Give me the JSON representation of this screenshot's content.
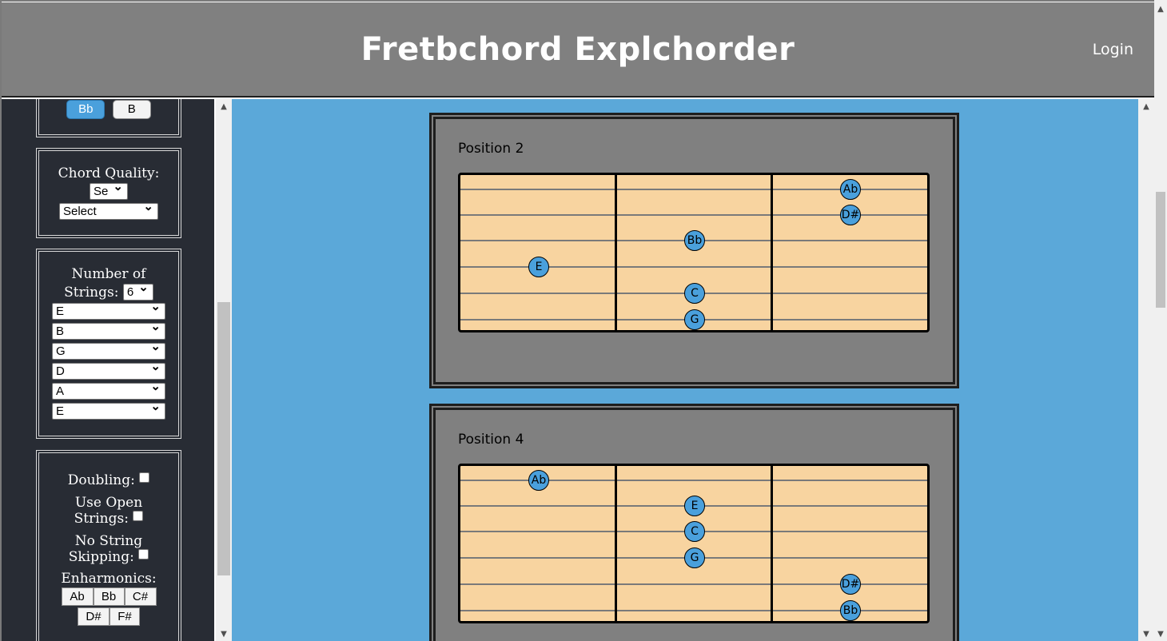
{
  "header": {
    "title": "Fretbchord Explchorder",
    "login": "Login"
  },
  "root_notes": {
    "buttons": [
      "Bb",
      "B"
    ],
    "active": "Bb"
  },
  "chord_quality": {
    "label": "Chord Quality:",
    "short_select": "Se",
    "select": "Select"
  },
  "strings": {
    "label_line1": "Number of",
    "label_line2": "Strings:",
    "count": "6",
    "tunings": [
      "E",
      "B",
      "G",
      "D",
      "A",
      "E"
    ]
  },
  "options": {
    "doubling": "Doubling:",
    "open_line1": "Use Open",
    "open_line2": "Strings:",
    "skip_line1": "No String",
    "skip_line2": "Skipping:",
    "enharmonics": "Enharmonics:",
    "enh_row1": [
      "Ab",
      "Bb",
      "C#"
    ],
    "enh_row2": [
      "D#",
      "F#"
    ]
  },
  "positions": [
    {
      "title": "Position 2",
      "notes": [
        {
          "label": "Ab",
          "string": 1,
          "fret": 3
        },
        {
          "label": "D#",
          "string": 2,
          "fret": 3
        },
        {
          "label": "Bb",
          "string": 3,
          "fret": 2
        },
        {
          "label": "E",
          "string": 4,
          "fret": 1
        },
        {
          "label": "C",
          "string": 5,
          "fret": 2
        },
        {
          "label": "G",
          "string": 6,
          "fret": 2
        }
      ]
    },
    {
      "title": "Position 4",
      "notes": [
        {
          "label": "Ab",
          "string": 1,
          "fret": 1
        },
        {
          "label": "E",
          "string": 2,
          "fret": 2
        },
        {
          "label": "C",
          "string": 3,
          "fret": 2
        },
        {
          "label": "G",
          "string": 4,
          "fret": 2
        },
        {
          "label": "D#",
          "string": 5,
          "fret": 3
        },
        {
          "label": "Bb",
          "string": 6,
          "fret": 3
        }
      ]
    }
  ]
}
